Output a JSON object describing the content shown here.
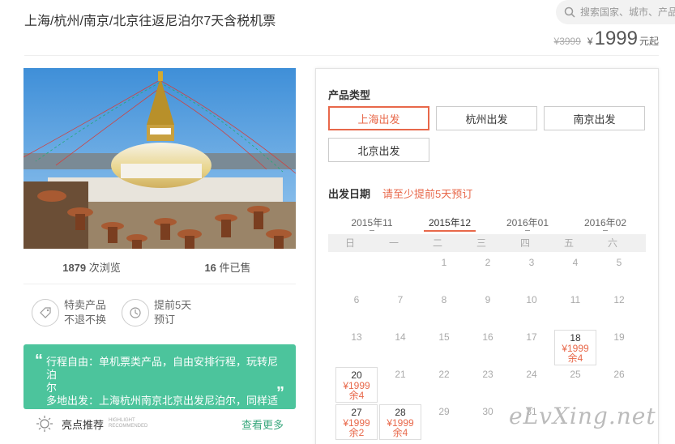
{
  "title": "上海/杭州/南京/北京往返尼泊尔7天含税机票",
  "search": {
    "placeholder": "搜索国家、城市、产品"
  },
  "price": {
    "old": "¥3999",
    "currency": "¥",
    "current": "1999",
    "unit": "元起"
  },
  "stats": {
    "views": "1879",
    "views_label": "次浏览",
    "sold": "16",
    "sold_label": "件已售"
  },
  "features": [
    {
      "icon": "tag-icon",
      "line1": "特卖产品",
      "line2": "不退不换"
    },
    {
      "icon": "clock-icon",
      "line1": "提前5天",
      "line2": "预订"
    }
  ],
  "description": {
    "line1": "行程自由：单机票类产品，自由安排行程，玩转尼泊",
    "line2": "尔",
    "line3": "多地出发：上海杭州南京北京出发尼泊尔，同样适"
  },
  "highlight": {
    "label": "亮点推荐",
    "en1": "HIGHLIGHT",
    "en2": "RECOMMENDED",
    "more": "查看更多"
  },
  "product_type": {
    "title": "产品类型",
    "options": [
      "上海出发",
      "杭州出发",
      "南京出发",
      "北京出发"
    ],
    "selected": "上海出发"
  },
  "departure": {
    "title": "出发日期",
    "notice": "请至少提前5天预订"
  },
  "calendar": {
    "months": [
      "2015年11",
      "2015年12",
      "2016年01",
      "2016年02"
    ],
    "active_month": "2015年12",
    "weekdays": [
      "日",
      "一",
      "二",
      "三",
      "四",
      "五",
      "六"
    ],
    "days": [
      {
        "d": "1",
        "col": 2,
        "row": 0
      },
      {
        "d": "2",
        "col": 3,
        "row": 0
      },
      {
        "d": "3",
        "col": 4,
        "row": 0
      },
      {
        "d": "4",
        "col": 5,
        "row": 0
      },
      {
        "d": "5",
        "col": 6,
        "row": 0
      },
      {
        "d": "6",
        "col": 0,
        "row": 1
      },
      {
        "d": "7",
        "col": 1,
        "row": 1
      },
      {
        "d": "8",
        "col": 2,
        "row": 1
      },
      {
        "d": "9",
        "col": 3,
        "row": 1
      },
      {
        "d": "10",
        "col": 4,
        "row": 1
      },
      {
        "d": "11",
        "col": 5,
        "row": 1
      },
      {
        "d": "12",
        "col": 6,
        "row": 1
      },
      {
        "d": "13",
        "col": 0,
        "row": 2
      },
      {
        "d": "14",
        "col": 1,
        "row": 2
      },
      {
        "d": "15",
        "col": 2,
        "row": 2
      },
      {
        "d": "16",
        "col": 3,
        "row": 2
      },
      {
        "d": "17",
        "col": 4,
        "row": 2
      },
      {
        "d": "18",
        "col": 5,
        "row": 2,
        "price": "¥1999",
        "left": "余4"
      },
      {
        "d": "19",
        "col": 6,
        "row": 2
      },
      {
        "d": "20",
        "col": 0,
        "row": 3,
        "price": "¥1999",
        "left": "余4"
      },
      {
        "d": "21",
        "col": 1,
        "row": 3
      },
      {
        "d": "22",
        "col": 2,
        "row": 3
      },
      {
        "d": "23",
        "col": 3,
        "row": 3
      },
      {
        "d": "24",
        "col": 4,
        "row": 3
      },
      {
        "d": "25",
        "col": 5,
        "row": 3
      },
      {
        "d": "26",
        "col": 6,
        "row": 3
      },
      {
        "d": "27",
        "col": 0,
        "row": 4,
        "price": "¥1999",
        "left": "余2"
      },
      {
        "d": "28",
        "col": 1,
        "row": 4,
        "price": "¥1999",
        "left": "余4"
      },
      {
        "d": "29",
        "col": 2,
        "row": 4
      },
      {
        "d": "30",
        "col": 3,
        "row": 4
      },
      {
        "d": "31",
        "col": 4,
        "row": 4
      }
    ]
  },
  "watermark": "eLvXing.net",
  "colors": {
    "accent": "#e8684a",
    "green": "#4cc49c",
    "link": "#3aa87e"
  }
}
